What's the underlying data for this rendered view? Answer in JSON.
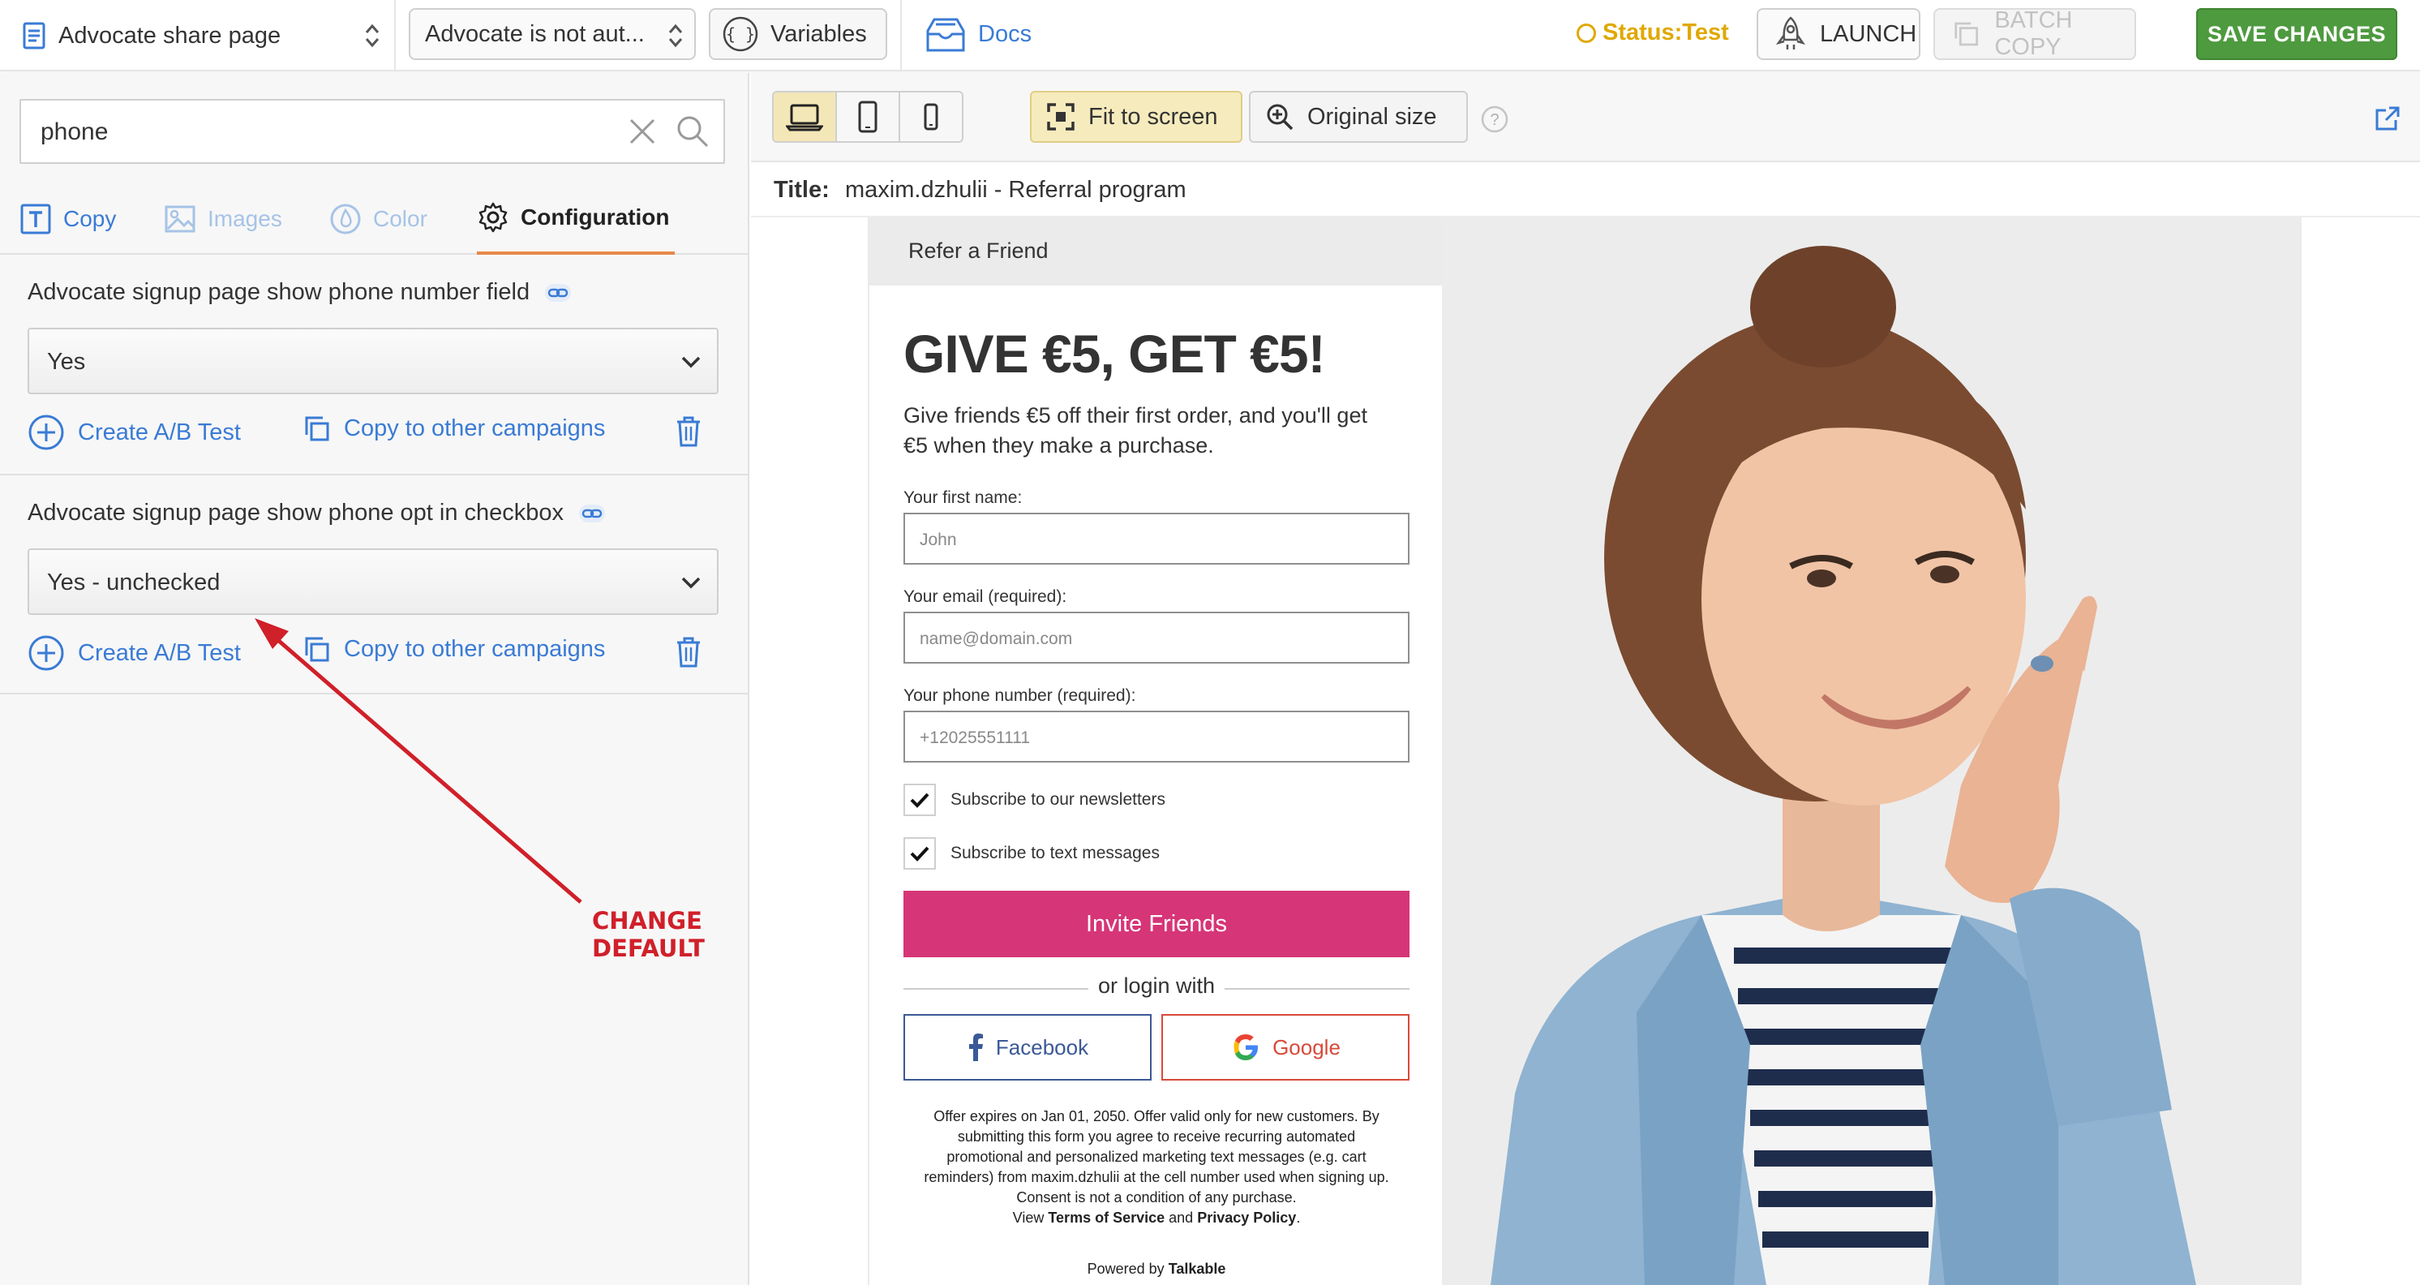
{
  "topbar": {
    "page_select": "Advocate share page",
    "auth_select": "Advocate is not aut...",
    "variables_label": "Variables",
    "docs_label": "Docs",
    "status_label": "Status:Test",
    "launch_label": "LAUNCH",
    "batch_copy_label": "BATCH COPY",
    "save_label": "SAVE CHANGES"
  },
  "left": {
    "search": {
      "value": "phone"
    },
    "tabs": [
      {
        "label": "Copy",
        "state": "link"
      },
      {
        "label": "Images",
        "state": "muted"
      },
      {
        "label": "Color",
        "state": "muted"
      },
      {
        "label": "Configuration",
        "state": "active"
      }
    ],
    "settings": [
      {
        "title": "Advocate signup page show phone number field",
        "value": "Yes",
        "ab_label": "Create A/B Test",
        "copy_label": "Copy to other campaigns"
      },
      {
        "title": "Advocate signup page show phone opt in checkbox",
        "value": "Yes - unchecked",
        "ab_label": "Create A/B Test",
        "copy_label": "Copy to other campaigns"
      }
    ],
    "annotation": "CHANGE DEFAULT"
  },
  "preview": {
    "fit_label": "Fit to screen",
    "original_label": "Original size",
    "title_label": "Title:",
    "title_value": "maxim.dzhulii - Referral program",
    "header": "Refer a Friend",
    "headline": "GIVE €5, GET €5!",
    "subtext": "Give friends €5 off their first order, and you'll get €5 when they make a purchase.",
    "fields": [
      {
        "label": "Your first name:",
        "placeholder": "John"
      },
      {
        "label": "Your email (required):",
        "placeholder": "name@domain.com"
      },
      {
        "label": "Your phone number (required):",
        "placeholder": "+12025551111"
      }
    ],
    "checkboxes": [
      {
        "label": "Subscribe to our newsletters",
        "checked": true
      },
      {
        "label": "Subscribe to text messages",
        "checked": true
      }
    ],
    "invite_label": "Invite Friends",
    "or_login": "or login with",
    "facebook_label": "Facebook",
    "google_label": "Google",
    "fine_print": "Offer expires on Jan 01, 2050. Offer valid only for new customers. By submitting this form you agree to receive recurring automated promotional and personalized marketing text messages (e.g. cart reminders) from maxim.dzhulii at the cell number used when signing up. Consent is not a condition of any purchase.",
    "view_prefix": "View",
    "terms_label": "Terms of Service",
    "and_label": "and",
    "privacy_label": "Privacy Policy",
    "powered_prefix": "Powered by",
    "powered_brand": "Talkable"
  },
  "colors": {
    "accent_blue": "#3a7bd5",
    "save_green": "#4e9a3f",
    "invite_pink": "#d63577",
    "status_yellow": "#e0a800",
    "annotation_red": "#d0202a"
  }
}
